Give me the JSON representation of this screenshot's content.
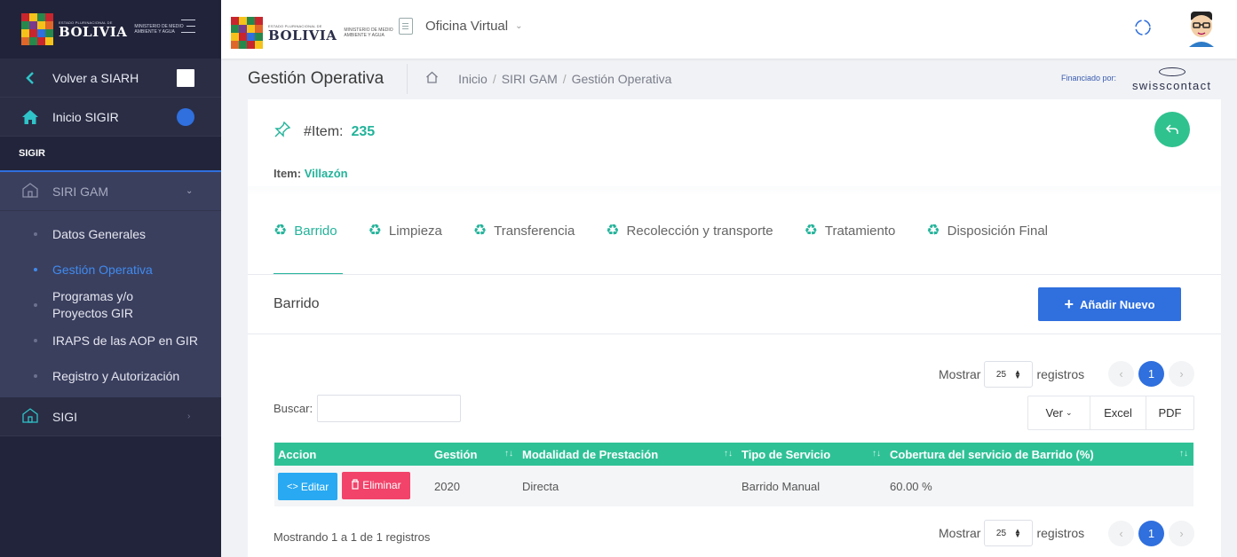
{
  "sidebar": {
    "logo": {
      "small": "ESTADO PLURINACIONAL DE",
      "big": "BOLIVIA",
      "ministry": "MINISTERIO DE MEDIO AMBIENTE Y AGUA"
    },
    "items": [
      {
        "label": "Volver a SIARH"
      },
      {
        "label": "Inicio SIGIR"
      }
    ],
    "section": "SIGIR",
    "group": {
      "label": "SIRI GAM"
    },
    "subitems": [
      {
        "label": "Datos Generales"
      },
      {
        "label": "Gestión Operativa"
      },
      {
        "label": "Programas y/o Proyectos GIR"
      },
      {
        "label": "IRAPS de las AOP en GIR"
      },
      {
        "label": "Registro y Autorización"
      }
    ],
    "sigi": {
      "label": "SIGI"
    }
  },
  "header": {
    "logo": {
      "small": "ESTADO PLURINACIONAL DE",
      "big": "BOLIVIA",
      "ministry": "MINISTERIO DE MEDIO AMBIENTE Y AGUA"
    },
    "app_menu": "Oficina Virtual"
  },
  "titlebar": {
    "title": "Gestión Operativa",
    "breadcrumb": [
      "Inicio",
      "SIRI GAM",
      "Gestión Operativa"
    ],
    "funded_by": "Financiado por:",
    "sponsor_a": "swiss",
    "sponsor_b": "contact"
  },
  "item": {
    "id_label": "#Item:",
    "id_value": "235",
    "name_label": "Item:",
    "name_value": "Villazón"
  },
  "tabs": [
    {
      "label": "Barrido"
    },
    {
      "label": "Limpieza"
    },
    {
      "label": "Transferencia"
    },
    {
      "label": "Recolección y transporte"
    },
    {
      "label": "Tratamiento"
    },
    {
      "label": "Disposición Final"
    }
  ],
  "section": {
    "title": "Barrido",
    "add_label": "Añadir Nuevo"
  },
  "list": {
    "show_label": "Mostrar",
    "page_size": "25",
    "records_label": "registros",
    "current_page": "1",
    "search_label": "Buscar:",
    "search_value": "",
    "buttons": [
      "Ver",
      "Excel",
      "PDF"
    ],
    "columns": [
      "Accion",
      "Gestión",
      "Modalidad de Prestación",
      "Tipo de Servicio",
      "Cobertura del servicio de Barrido (%)"
    ],
    "rows": [
      {
        "edit": "Editar",
        "delete": "Eliminar",
        "gestion": "2020",
        "modalidad": "Directa",
        "tipo": "Barrido Manual",
        "cobertura": "60.00 %"
      }
    ],
    "info": "Mostrando 1 a 1 de 1 registros"
  },
  "colors": {
    "accent": "#23b39a",
    "primary": "#2f6fde",
    "sidebar": "#21243a"
  }
}
